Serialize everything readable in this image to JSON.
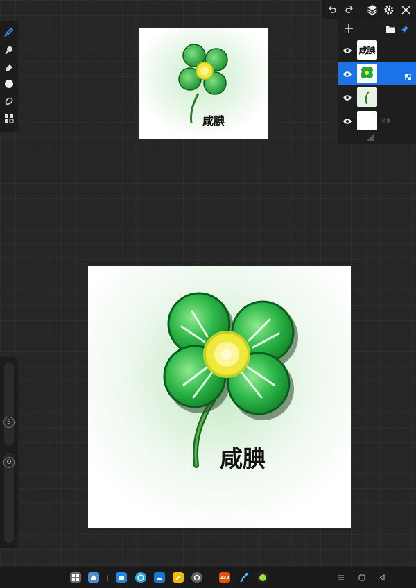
{
  "canvas": {
    "artwork_text": "咸腆"
  },
  "layers_panel": {
    "layers": [
      {
        "name": "text-layer",
        "thumb_text": "咸腆",
        "visible": true,
        "selected": false
      },
      {
        "name": "clover-layer",
        "thumb_text": "",
        "visible": true,
        "selected": true
      },
      {
        "name": "stem-layer",
        "thumb_text": "",
        "visible": true,
        "selected": false
      },
      {
        "name": "background-layer",
        "thumb_text": "",
        "sub_label": "背景",
        "visible": true,
        "selected": false
      }
    ]
  },
  "taskbar": {
    "apps": [
      {
        "name": "app-drawer",
        "color": "#6d6d6d"
      },
      {
        "name": "home",
        "color": "#4a8fd8"
      },
      {
        "name": "files",
        "color": "#1e88e5"
      },
      {
        "name": "browser",
        "color": "#29a8e0"
      },
      {
        "name": "gallery",
        "color": "#1976d2"
      },
      {
        "name": "notes",
        "color": "#f5b800"
      },
      {
        "name": "settings",
        "color": "#5f6368"
      },
      {
        "name": "app-233",
        "color": "#e65100",
        "label": "233"
      },
      {
        "name": "paint-brush",
        "color": "#1a1a1a"
      },
      {
        "name": "green-app",
        "color": "#222"
      }
    ]
  },
  "colors": {
    "accent": "#1a73e8",
    "clover_green": "#1faa3c",
    "clover_center": "#f0e83a"
  }
}
